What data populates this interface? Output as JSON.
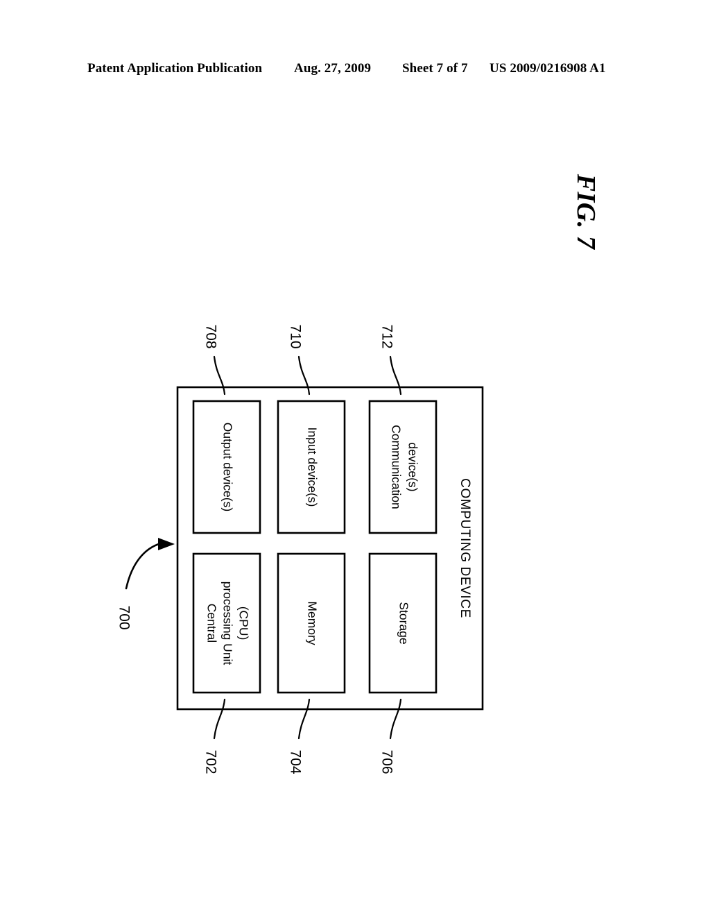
{
  "header": {
    "publication": "Patent Application Publication",
    "date": "Aug. 27, 2009",
    "sheet": "Sheet 7 of 7",
    "patent_number": "US 2009/0216908 A1"
  },
  "figure": {
    "label": "FIG. 7",
    "assembly_reference": "700"
  },
  "diagram": {
    "container_label": "COMPUTING DEVICE",
    "blocks": [
      {
        "id": "cpu",
        "line1": "Central",
        "line2": "processing Unit",
        "line3": "(CPU)",
        "reference": "702"
      },
      {
        "id": "memory",
        "line1": "Memory",
        "line2": "",
        "line3": "",
        "reference": "704"
      },
      {
        "id": "storage",
        "line1": "Storage",
        "line2": "",
        "line3": "",
        "reference": "706"
      },
      {
        "id": "output",
        "line1": "Output device(s)",
        "line2": "",
        "line3": "",
        "reference": "708"
      },
      {
        "id": "input",
        "line1": "Input device(s)",
        "line2": "",
        "line3": "",
        "reference": "710"
      },
      {
        "id": "comm",
        "line1": "Communication",
        "line2": "device(s)",
        "line3": "",
        "reference": "712"
      }
    ]
  },
  "colors": {
    "ink": "#000000",
    "paper": "#ffffff"
  }
}
